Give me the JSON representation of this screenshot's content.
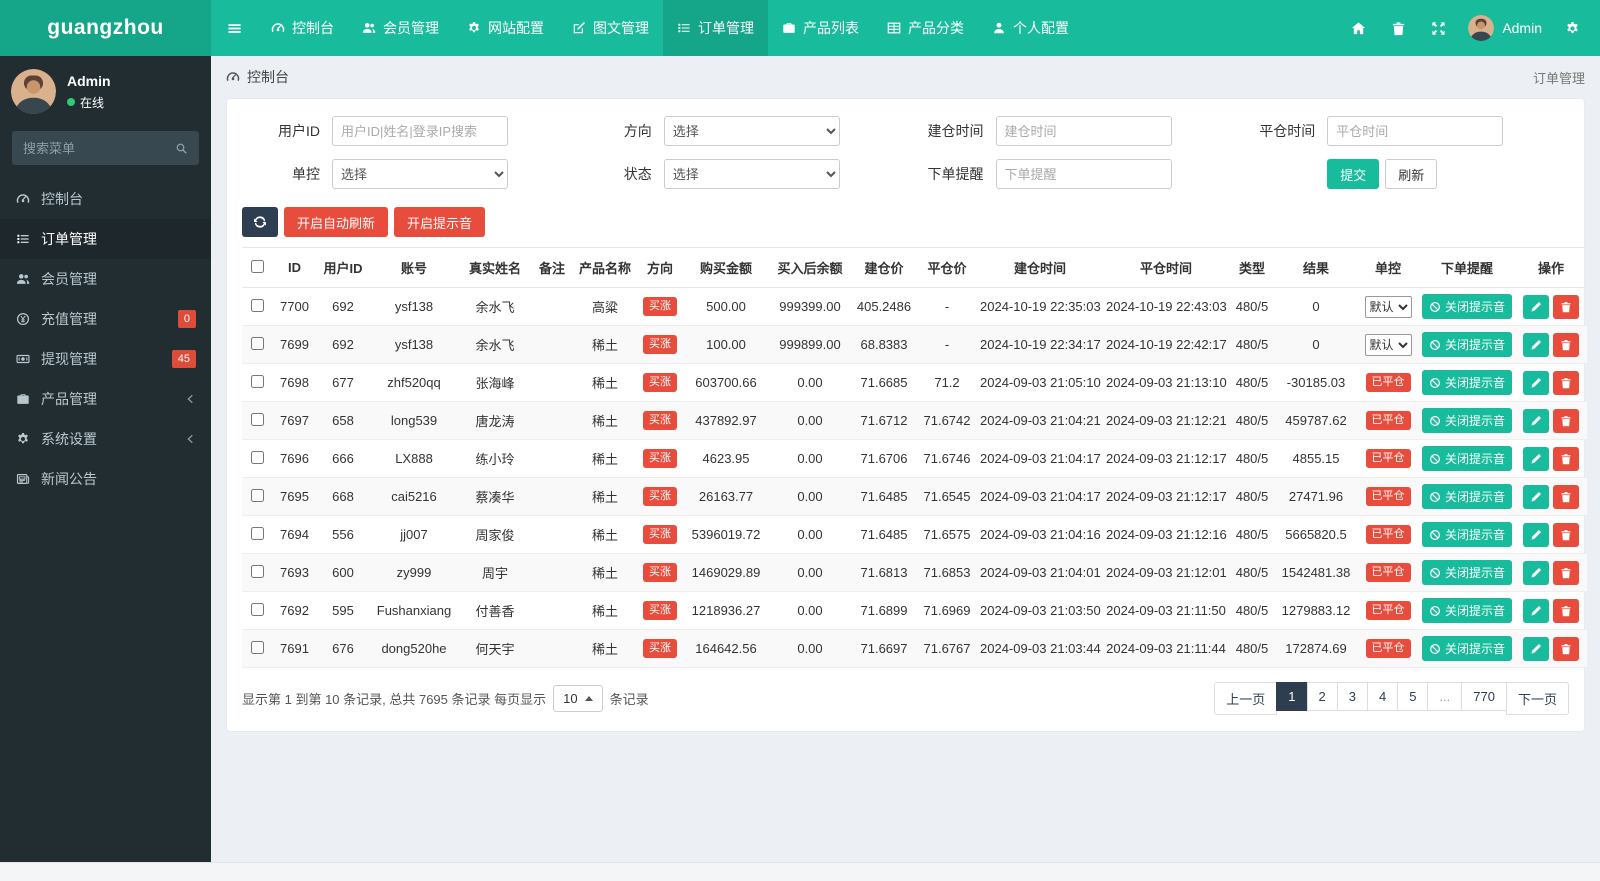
{
  "colors": {
    "accent": "#18bc9c",
    "accent_dark": "#15a589",
    "primary": "#2c3e50",
    "danger": "#e74c3c",
    "sidebar": "#222d32"
  },
  "navbar": {
    "brand": "guangzhou",
    "toggle_icon": "hamburger",
    "items": [
      {
        "key": "console",
        "icon": "dashboard",
        "label": "控制台",
        "active": false
      },
      {
        "key": "members",
        "icon": "users",
        "label": "会员管理",
        "active": false
      },
      {
        "key": "site-config",
        "icon": "gear",
        "label": "网站配置",
        "active": false
      },
      {
        "key": "content",
        "icon": "edit",
        "label": "图文管理",
        "active": false
      },
      {
        "key": "orders",
        "icon": "list",
        "label": "订单管理",
        "active": true
      },
      {
        "key": "product-list",
        "icon": "briefcase",
        "label": "产品列表",
        "active": false
      },
      {
        "key": "product-category",
        "icon": "table",
        "label": "产品分类",
        "active": false
      },
      {
        "key": "profile",
        "icon": "user",
        "label": "个人配置",
        "active": false
      }
    ],
    "right": {
      "home_icon": "home",
      "trash_icon": "trash",
      "fullscreen_icon": "expand",
      "settings_icon": "cogs",
      "avatar_icon": "avatar",
      "username": "Admin"
    }
  },
  "sidebar": {
    "user": {
      "name": "Admin",
      "status": "在线",
      "avatar_icon": "avatar"
    },
    "search_placeholder": "搜索菜单",
    "search_icon": "search",
    "items": [
      {
        "key": "console",
        "icon": "dashboard",
        "label": "控制台",
        "active": false
      },
      {
        "key": "orders",
        "icon": "list",
        "label": "订单管理",
        "active": true
      },
      {
        "key": "members",
        "icon": "users",
        "label": "会员管理",
        "active": false
      },
      {
        "key": "recharge",
        "icon": "recharge",
        "label": "充值管理",
        "badge": "0"
      },
      {
        "key": "withdraw",
        "icon": "money",
        "label": "提现管理",
        "badge": "45"
      },
      {
        "key": "products",
        "icon": "briefcase",
        "label": "产品管理",
        "arrow": true
      },
      {
        "key": "settings",
        "icon": "cogs",
        "label": "系统设置",
        "arrow": true
      },
      {
        "key": "news",
        "icon": "news",
        "label": "新闻公告"
      }
    ]
  },
  "breadcrumb": {
    "icon": "dashboard",
    "left": "控制台",
    "right": "订单管理"
  },
  "filters": {
    "user_id": {
      "label": "用户ID",
      "placeholder": "用户ID|姓名|登录IP搜索"
    },
    "direction": {
      "label": "方向",
      "value": "选择"
    },
    "open_time": {
      "label": "建仓时间",
      "placeholder": "建仓时间"
    },
    "close_time": {
      "label": "平仓时间",
      "placeholder": "平仓时间"
    },
    "control": {
      "label": "单控",
      "value": "选择"
    },
    "status": {
      "label": "状态",
      "value": "选择"
    },
    "remind": {
      "label": "下单提醒",
      "placeholder": "下单提醒"
    },
    "submit_label": "提交",
    "refresh_label": "刷新"
  },
  "toolbar": {
    "refresh_icon": "refresh",
    "auto_refresh_label": "开启自动刷新",
    "sound_label": "开启提示音"
  },
  "table": {
    "headers": [
      "ID",
      "用户ID",
      "账号",
      "真实姓名",
      "备注",
      "产品名称",
      "方向",
      "购买金额",
      "买入后余额",
      "建仓价",
      "平仓价",
      "建仓时间",
      "平仓时间",
      "类型",
      "结果",
      "单控",
      "下单提醒",
      "操作"
    ],
    "close_sound_label": "关闭提示音",
    "sound_icon": "ban",
    "edit_icon": "pencil",
    "delete_icon": "trash",
    "rows": [
      {
        "id": "7700",
        "user_id": "692",
        "account": "ysf138",
        "real_name": "余水飞",
        "remark": "",
        "product": "高粱",
        "direction": "买涨",
        "amount": "500.00",
        "balance_after": "999399.00",
        "open_price": "405.2486",
        "close_price": "-",
        "open_time": "2024-10-19 22:35:03",
        "close_time": "2024-10-19 22:43:03",
        "type": "480/5",
        "result": "0",
        "control": {
          "type": "select",
          "value": "默认"
        }
      },
      {
        "id": "7699",
        "user_id": "692",
        "account": "ysf138",
        "real_name": "余水飞",
        "remark": "",
        "product": "稀土",
        "direction": "买涨",
        "amount": "100.00",
        "balance_after": "999899.00",
        "open_price": "68.8383",
        "close_price": "-",
        "open_time": "2024-10-19 22:34:17",
        "close_time": "2024-10-19 22:42:17",
        "type": "480/5",
        "result": "0",
        "control": {
          "type": "select",
          "value": "默认"
        }
      },
      {
        "id": "7698",
        "user_id": "677",
        "account": "zhf520qq",
        "real_name": "张海峰",
        "remark": "",
        "product": "稀土",
        "direction": "买涨",
        "amount": "603700.66",
        "balance_after": "0.00",
        "open_price": "71.6685",
        "close_price": "71.2",
        "open_time": "2024-09-03 21:05:10",
        "close_time": "2024-09-03 21:13:10",
        "type": "480/5",
        "result": "-30185.03",
        "control": {
          "type": "badge",
          "value": "已平仓"
        }
      },
      {
        "id": "7697",
        "user_id": "658",
        "account": "long539",
        "real_name": "唐龙涛",
        "remark": "",
        "product": "稀土",
        "direction": "买涨",
        "amount": "437892.97",
        "balance_after": "0.00",
        "open_price": "71.6712",
        "close_price": "71.6742",
        "open_time": "2024-09-03 21:04:21",
        "close_time": "2024-09-03 21:12:21",
        "type": "480/5",
        "result": "459787.62",
        "control": {
          "type": "badge",
          "value": "已平仓"
        }
      },
      {
        "id": "7696",
        "user_id": "666",
        "account": "LX888",
        "real_name": "练小玲",
        "remark": "",
        "product": "稀土",
        "direction": "买涨",
        "amount": "4623.95",
        "balance_after": "0.00",
        "open_price": "71.6706",
        "close_price": "71.6746",
        "open_time": "2024-09-03 21:04:17",
        "close_time": "2024-09-03 21:12:17",
        "type": "480/5",
        "result": "4855.15",
        "control": {
          "type": "badge",
          "value": "已平仓"
        }
      },
      {
        "id": "7695",
        "user_id": "668",
        "account": "cai5216",
        "real_name": "蔡凑华",
        "remark": "",
        "product": "稀土",
        "direction": "买涨",
        "amount": "26163.77",
        "balance_after": "0.00",
        "open_price": "71.6485",
        "close_price": "71.6545",
        "open_time": "2024-09-03 21:04:17",
        "close_time": "2024-09-03 21:12:17",
        "type": "480/5",
        "result": "27471.96",
        "control": {
          "type": "badge",
          "value": "已平仓"
        }
      },
      {
        "id": "7694",
        "user_id": "556",
        "account": "jj007",
        "real_name": "周家俊",
        "remark": "",
        "product": "稀土",
        "direction": "买涨",
        "amount": "5396019.72",
        "balance_after": "0.00",
        "open_price": "71.6485",
        "close_price": "71.6575",
        "open_time": "2024-09-03 21:04:16",
        "close_time": "2024-09-03 21:12:16",
        "type": "480/5",
        "result": "5665820.5",
        "control": {
          "type": "badge",
          "value": "已平仓"
        }
      },
      {
        "id": "7693",
        "user_id": "600",
        "account": "zy999",
        "real_name": "周宇",
        "remark": "",
        "product": "稀土",
        "direction": "买涨",
        "amount": "1469029.89",
        "balance_after": "0.00",
        "open_price": "71.6813",
        "close_price": "71.6853",
        "open_time": "2024-09-03 21:04:01",
        "close_time": "2024-09-03 21:12:01",
        "type": "480/5",
        "result": "1542481.38",
        "control": {
          "type": "badge",
          "value": "已平仓"
        }
      },
      {
        "id": "7692",
        "user_id": "595",
        "account": "Fushanxiang",
        "real_name": "付善香",
        "remark": "",
        "product": "稀土",
        "direction": "买涨",
        "amount": "1218936.27",
        "balance_after": "0.00",
        "open_price": "71.6899",
        "close_price": "71.6969",
        "open_time": "2024-09-03 21:03:50",
        "close_time": "2024-09-03 21:11:50",
        "type": "480/5",
        "result": "1279883.12",
        "control": {
          "type": "badge",
          "value": "已平仓"
        }
      },
      {
        "id": "7691",
        "user_id": "676",
        "account": "dong520he",
        "real_name": "何天宇",
        "remark": "",
        "product": "稀土",
        "direction": "买涨",
        "amount": "164642.56",
        "balance_after": "0.00",
        "open_price": "71.6697",
        "close_price": "71.6767",
        "open_time": "2024-09-03 21:03:44",
        "close_time": "2024-09-03 21:11:44",
        "type": "480/5",
        "result": "172874.69",
        "control": {
          "type": "badge",
          "value": "已平仓"
        }
      }
    ]
  },
  "pagination": {
    "summary_prefix": "显示第 1 到第 10 条记录, 总共 7695 条记录 每页显示",
    "page_size": "10",
    "summary_suffix": "条记录",
    "pages": [
      {
        "label": "上一页"
      },
      {
        "label": "1",
        "active": true
      },
      {
        "label": "2"
      },
      {
        "label": "3"
      },
      {
        "label": "4"
      },
      {
        "label": "5"
      },
      {
        "label": "...",
        "disabled": true
      },
      {
        "label": "770"
      },
      {
        "label": "下一页"
      }
    ]
  }
}
